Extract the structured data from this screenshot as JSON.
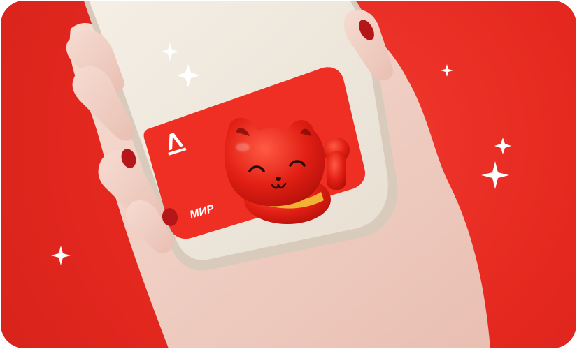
{
  "scene": {
    "background_color": "#e8291f",
    "description_tags": [
      "hand-holding-phone",
      "bank-card",
      "lucky-cat"
    ]
  },
  "card": {
    "bank_logo_text": "А",
    "payment_system_text": "МИР",
    "card_color": "#ef2f23"
  },
  "icons": [
    "sparkle-icon",
    "bank-logo-icon",
    "lucky-cat-icon"
  ]
}
